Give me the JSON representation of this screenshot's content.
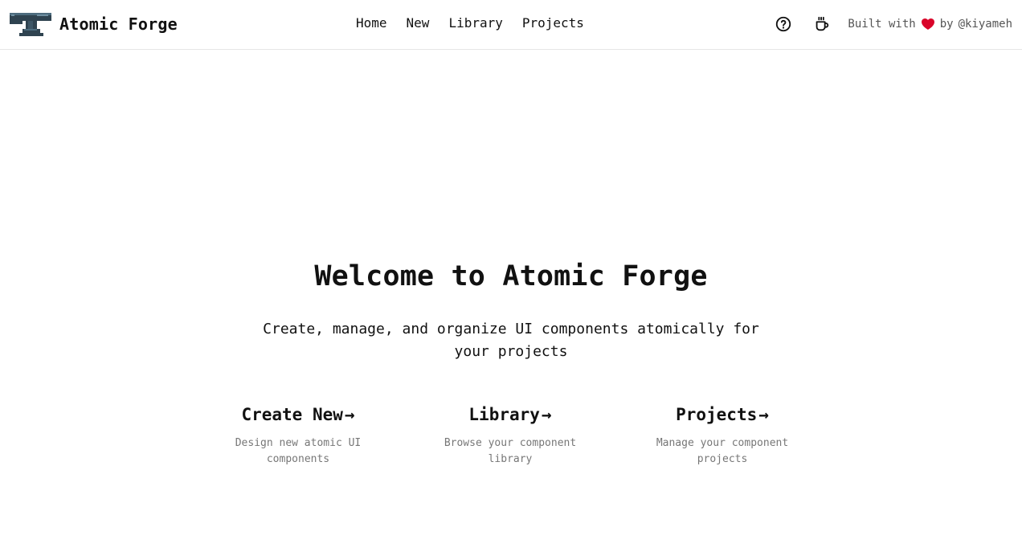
{
  "header": {
    "brand_title": "Atomic Forge",
    "logo_icon": "anvil-icon",
    "nav": [
      {
        "label": "Home"
      },
      {
        "label": "New"
      },
      {
        "label": "Library"
      },
      {
        "label": "Projects"
      }
    ],
    "help_icon": "help-circle-icon",
    "coffee_icon": "coffee-cup-icon",
    "credit": {
      "prefix": "Built with",
      "heart_icon": "heart-icon",
      "suffix": "by",
      "handle": "@kiyameh",
      "heart_color": "#d90429"
    }
  },
  "main": {
    "title": "Welcome to Atomic Forge",
    "subtitle": "Create, manage, and organize UI components atomically for your projects",
    "cards": [
      {
        "title": "Create New",
        "arrow": "→",
        "description": "Design new atomic UI components"
      },
      {
        "title": "Library",
        "arrow": "→",
        "description": "Browse your component library"
      },
      {
        "title": "Projects",
        "arrow": "→",
        "description": "Manage your component projects"
      }
    ]
  }
}
